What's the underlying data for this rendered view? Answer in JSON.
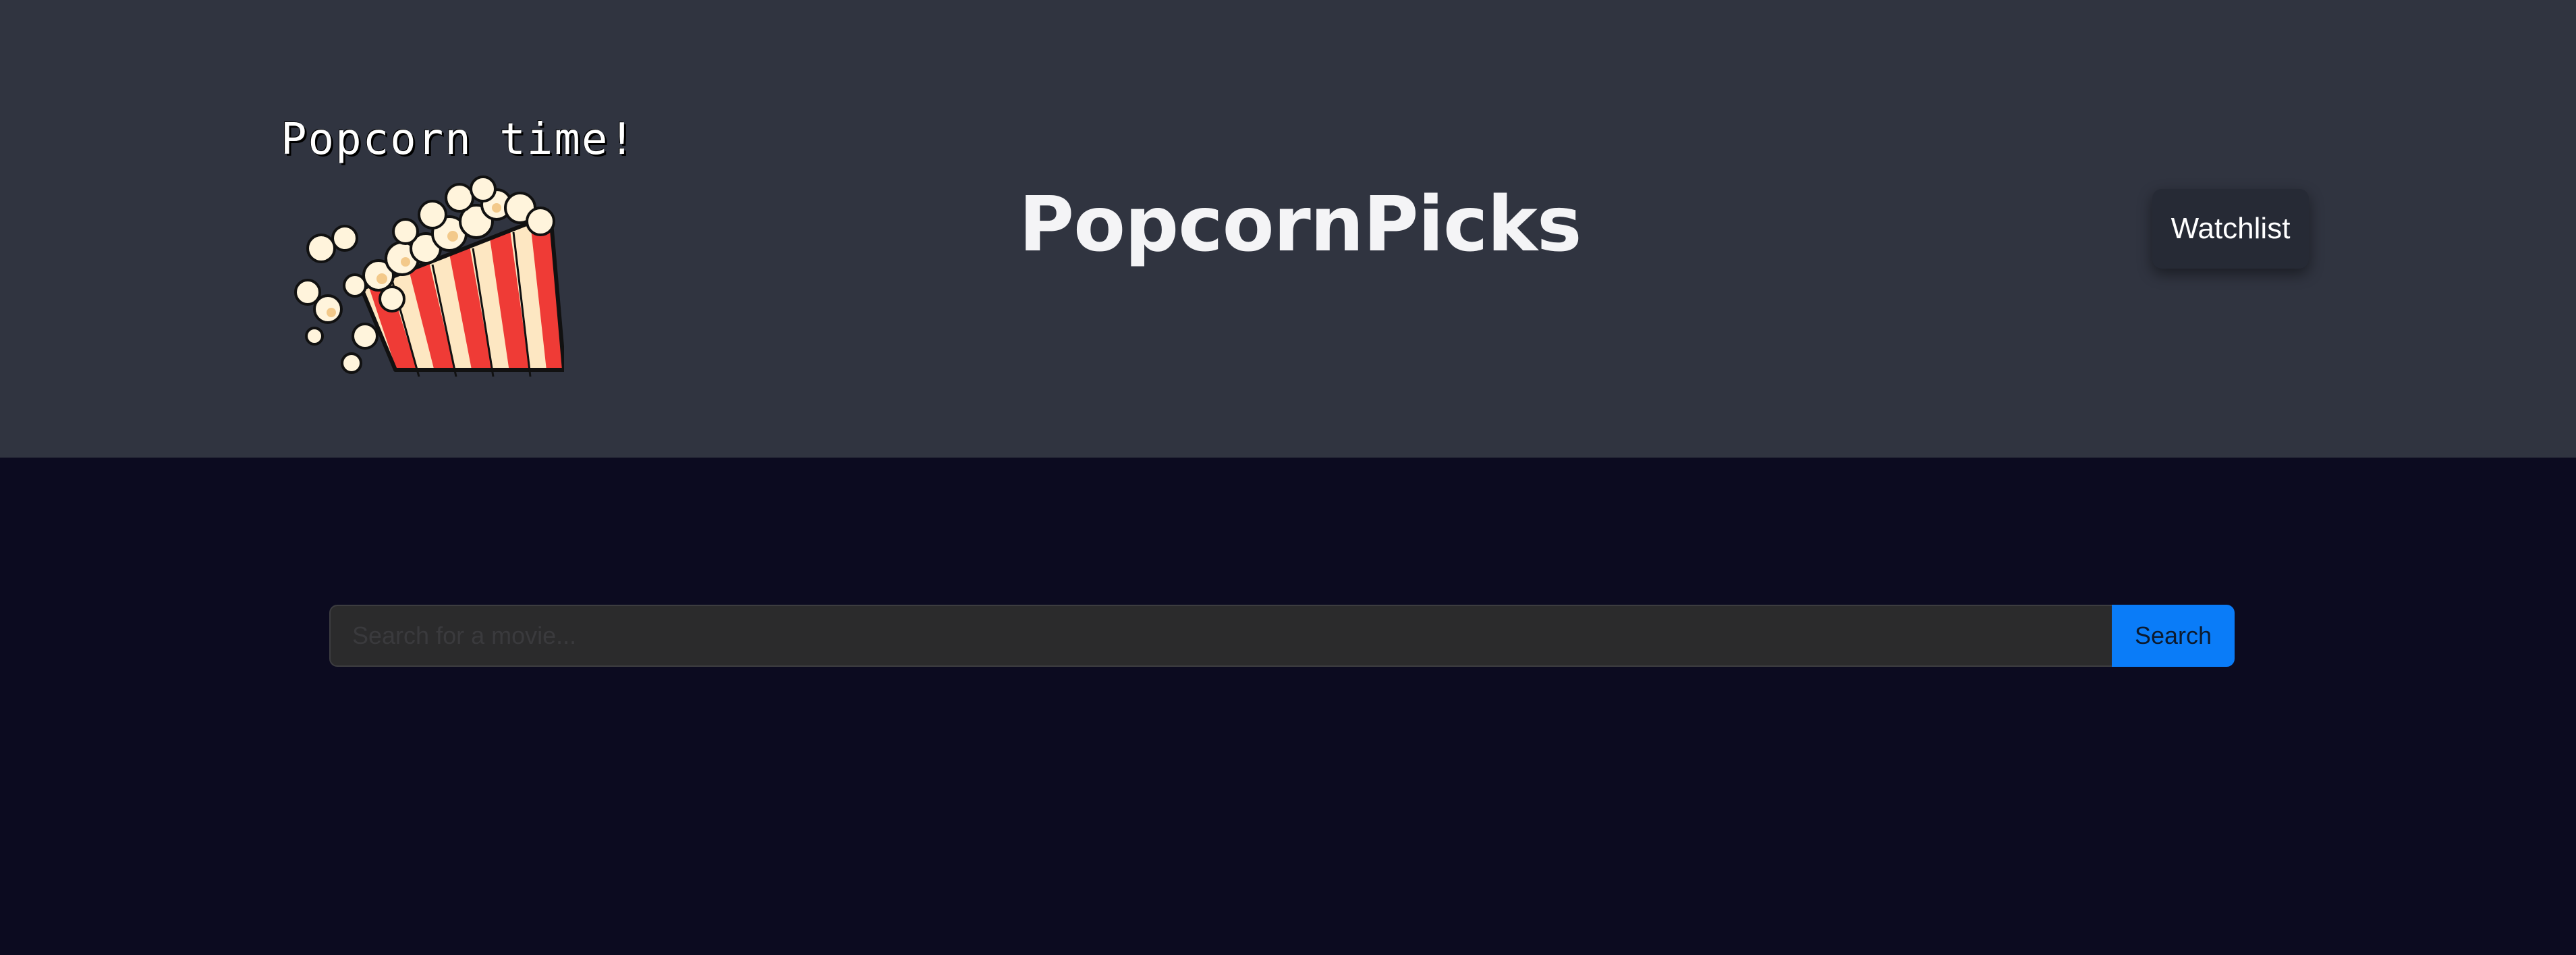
{
  "header": {
    "logo_caption": "Popcorn time!",
    "logo_icon": "popcorn-bucket-icon",
    "site_title": "PopcornPicks",
    "watchlist_label": "Watchlist"
  },
  "search": {
    "placeholder": "Search for a movie...",
    "value": "",
    "button_label": "Search"
  },
  "colors": {
    "header_bg": "#303440",
    "page_bg": "#0c0b20",
    "search_button": "#0a7cf8",
    "popcorn_stripe_red": "#ef3b36",
    "popcorn_stripe_cream": "#fde7c2"
  }
}
